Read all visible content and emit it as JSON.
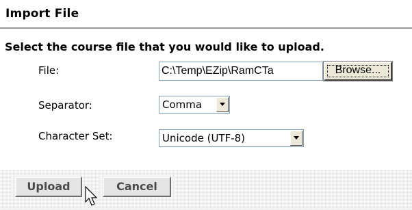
{
  "header": {
    "title": "Import File"
  },
  "form": {
    "instruction": "Select the course file that you would like to upload.",
    "file": {
      "label": "File:",
      "value": "C:\\Temp\\EZip\\RamCTa",
      "browse_label": "Browse..."
    },
    "separator": {
      "label": "Separator:",
      "selected": "Comma"
    },
    "charset": {
      "label": "Character Set:",
      "selected": "Unicode (UTF-8)"
    }
  },
  "actions": {
    "upload_label": "Upload",
    "cancel_label": "Cancel"
  },
  "icons": {
    "dropdown": "chevron-down-icon",
    "pointer": "mouse-pointer-icon"
  },
  "colors": {
    "rule": "#9a9a9a",
    "input_border": "#7f9db9",
    "button_face": "#ece9d8",
    "action_text": "#4a4a4a"
  }
}
